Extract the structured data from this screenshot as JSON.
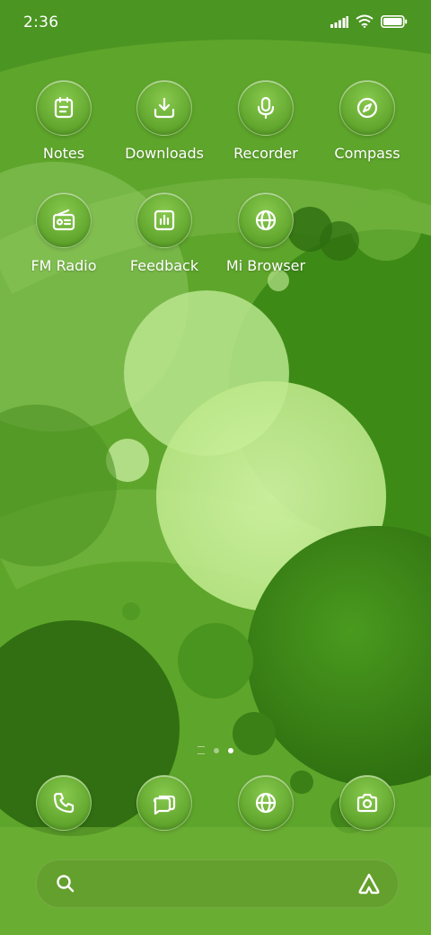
{
  "status_bar": {
    "time": "2:36"
  },
  "home_apps": [
    {
      "label": "Notes",
      "icon": "notes-icon"
    },
    {
      "label": "Downloads",
      "icon": "download-icon"
    },
    {
      "label": "Recorder",
      "icon": "microphone-icon"
    },
    {
      "label": "Compass",
      "icon": "compass-icon"
    },
    {
      "label": "FM Radio",
      "icon": "radio-icon"
    },
    {
      "label": "Feedback",
      "icon": "feedback-chart-icon"
    },
    {
      "label": "Mi Browser",
      "icon": "globe-icon"
    }
  ],
  "dock": [
    {
      "icon": "phone-icon"
    },
    {
      "icon": "messages-icon"
    },
    {
      "icon": "globe-icon"
    },
    {
      "icon": "camera-icon"
    }
  ],
  "page_indicator": {
    "pages": 2,
    "active": 2
  },
  "search_bar": {
    "icon": "search-icon",
    "assistant_icon": "assistant-icon"
  },
  "colors": {
    "wallpaper": "#5aa62a",
    "icon_fill": "#6aae35",
    "text": "#ffffff"
  }
}
